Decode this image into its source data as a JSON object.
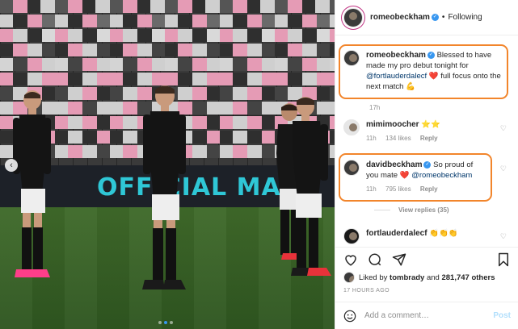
{
  "photo": {
    "banner_text": "OFFICIAL MA",
    "carousel_prev_icon": "chevron-left-icon",
    "carousel": {
      "count": 3,
      "active": 1
    }
  },
  "header": {
    "username": "romeobeckham",
    "separator": "•",
    "follow_label": "Following",
    "verified_icon": "verified-badge-icon"
  },
  "caption": {
    "username": "romeobeckham",
    "text_before": "Blessed to have made my pro debut tonight for ",
    "mention": "@fortlauderdalecf",
    "emoji_heart": "❤️",
    "text_after": " full focus onto the next match ",
    "emoji_end": "💪",
    "time": "17h"
  },
  "comments": [
    {
      "username": "mimimoocher",
      "text": "⭐⭐",
      "time": "11h",
      "likes": "134 likes",
      "reply": "Reply"
    },
    {
      "username": "davidbeckham",
      "text_before": "So proud of you mate ",
      "emoji": "❤️",
      "mention": "@romeobeckham",
      "time": "11h",
      "likes": "795 likes",
      "reply": "Reply"
    },
    {
      "username": "fortlauderdalecf",
      "text": "👏👏👏"
    }
  ],
  "view_replies": "View replies (35)",
  "liked_by": {
    "prefix": "Liked by ",
    "user": "tombrady",
    "middle": " and ",
    "count": "281,747 others"
  },
  "timestamp": "17 HOURS AGO",
  "add_comment": {
    "placeholder": "Add a comment…",
    "post_label": "Post"
  },
  "colors": {
    "highlight": "#f2852b",
    "verified": "#3897f0",
    "mention": "#00376b",
    "heart": "#ed4956",
    "banner_text": "#2fc7d6"
  }
}
